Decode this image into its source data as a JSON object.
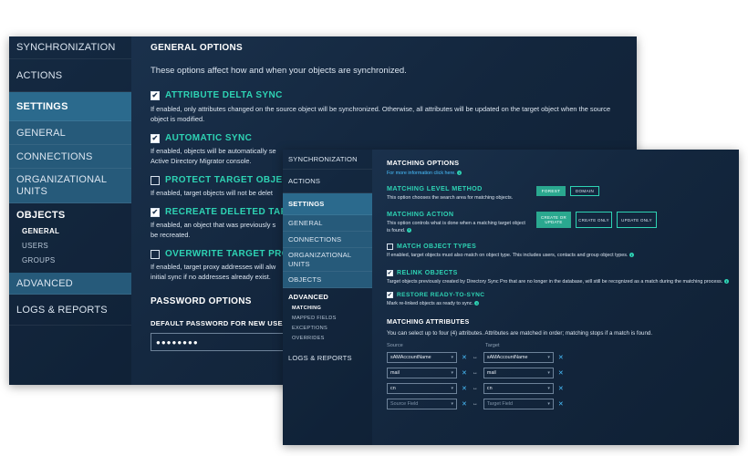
{
  "back_window": {
    "sidebar": {
      "items": [
        {
          "label": "SYNCHRONIZATION"
        },
        {
          "label": "ACTIONS"
        },
        {
          "label": "SETTINGS"
        },
        {
          "label": "GENERAL"
        },
        {
          "label": "CONNECTIONS"
        },
        {
          "label": "ORGANIZATIONAL UNITS"
        },
        {
          "label": "OBJECTS"
        },
        {
          "label": "ADVANCED"
        },
        {
          "label": "LOGS & REPORTS"
        }
      ],
      "sub_items": [
        "GENERAL",
        "USERS",
        "GROUPS"
      ]
    },
    "content": {
      "heading": "GENERAL OPTIONS",
      "intro": "These options affect how and when your objects are synchronized.",
      "options": [
        {
          "title": "ATTRIBUTE DELTA SYNC",
          "checked": true,
          "desc": "If enabled, only attributes changed on the source object will be synchronized. Otherwise, all attributes will be updated on the target object when the source object is modified."
        },
        {
          "title": "AUTOMATIC SYNC",
          "checked": true,
          "desc": "If enabled, objects will be automatically se",
          "desc2": "Active Directory Migrator console."
        },
        {
          "title": "PROTECT TARGET OBJEC",
          "checked": false,
          "desc": "If enabled, target objects will not be delet"
        },
        {
          "title": "RECREATE DELETED TARG",
          "checked": true,
          "desc": "If enabled, an object that was previously s",
          "desc2": "be recreated."
        },
        {
          "title": "OVERWRITE TARGET PRO",
          "checked": false,
          "desc": "If enabled, target proxy addresses will alw",
          "desc2": "initial sync if no addresses already exist."
        }
      ],
      "password_heading": "PASSWORD OPTIONS",
      "password_label": "DEFAULT PASSWORD FOR NEW USERS",
      "password_value": "●●●●●●●●"
    }
  },
  "front_window": {
    "sidebar": {
      "items": [
        {
          "label": "SYNCHRONIZATION"
        },
        {
          "label": "ACTIONS"
        },
        {
          "label": "SETTINGS"
        },
        {
          "label": "GENERAL"
        },
        {
          "label": "CONNECTIONS"
        },
        {
          "label": "ORGANIZATIONAL UNITS"
        },
        {
          "label": "OBJECTS"
        },
        {
          "label": "ADVANCED"
        },
        {
          "label": "LOGS & REPORTS"
        }
      ],
      "sub_items": [
        "MATCHING",
        "MAPPED FIELDS",
        "EXCEPTIONS",
        "OVERRIDES"
      ]
    },
    "content": {
      "heading": "MATCHING OPTIONS",
      "more_info": "For more information click here.",
      "level_heading": "MATCHING LEVEL METHOD",
      "level_desc": "This option chooses the search area for matching objects.",
      "level_buttons": [
        "FOREST",
        "DOMAIN"
      ],
      "action_heading": "MATCHING ACTION",
      "action_desc": "This option controls what is done when a matching target object is found.",
      "action_buttons": [
        "CREATE OR UPDATE",
        "CREATE ONLY",
        "UPDATE ONLY"
      ],
      "match_types_title": "MATCH OBJECT TYPES",
      "match_types_desc": "If enabled, target objects must also match on object type. This includes users, contacts and group object types.",
      "relink_title": "RELINK OBJECTS",
      "relink_desc": "Target objects previously created by Directory Sync Pro that are no longer in the database, will still be recognized as a match during the matching process.",
      "restore_title": "RESTORE READY-TO-SYNC",
      "restore_desc": "Mark re-linked objects as ready to sync.",
      "attributes_heading": "MATCHING ATTRIBUTES",
      "attributes_desc": "You can select up to four (4) attributes. Attributes are matched in order; matching stops if a match is found.",
      "source_label": "Source",
      "target_label": "Target",
      "rows": [
        {
          "source": "sAMAccountName",
          "target": "sAMAccountName"
        },
        {
          "source": "mail",
          "target": "mail"
        },
        {
          "source": "cn",
          "target": "cn"
        },
        {
          "source": "Source Field",
          "target": "Target Field"
        }
      ]
    }
  },
  "colors": {
    "accent": "#2ed3b4",
    "selected_nav": "#2b6a8d",
    "background": "#17304a"
  }
}
